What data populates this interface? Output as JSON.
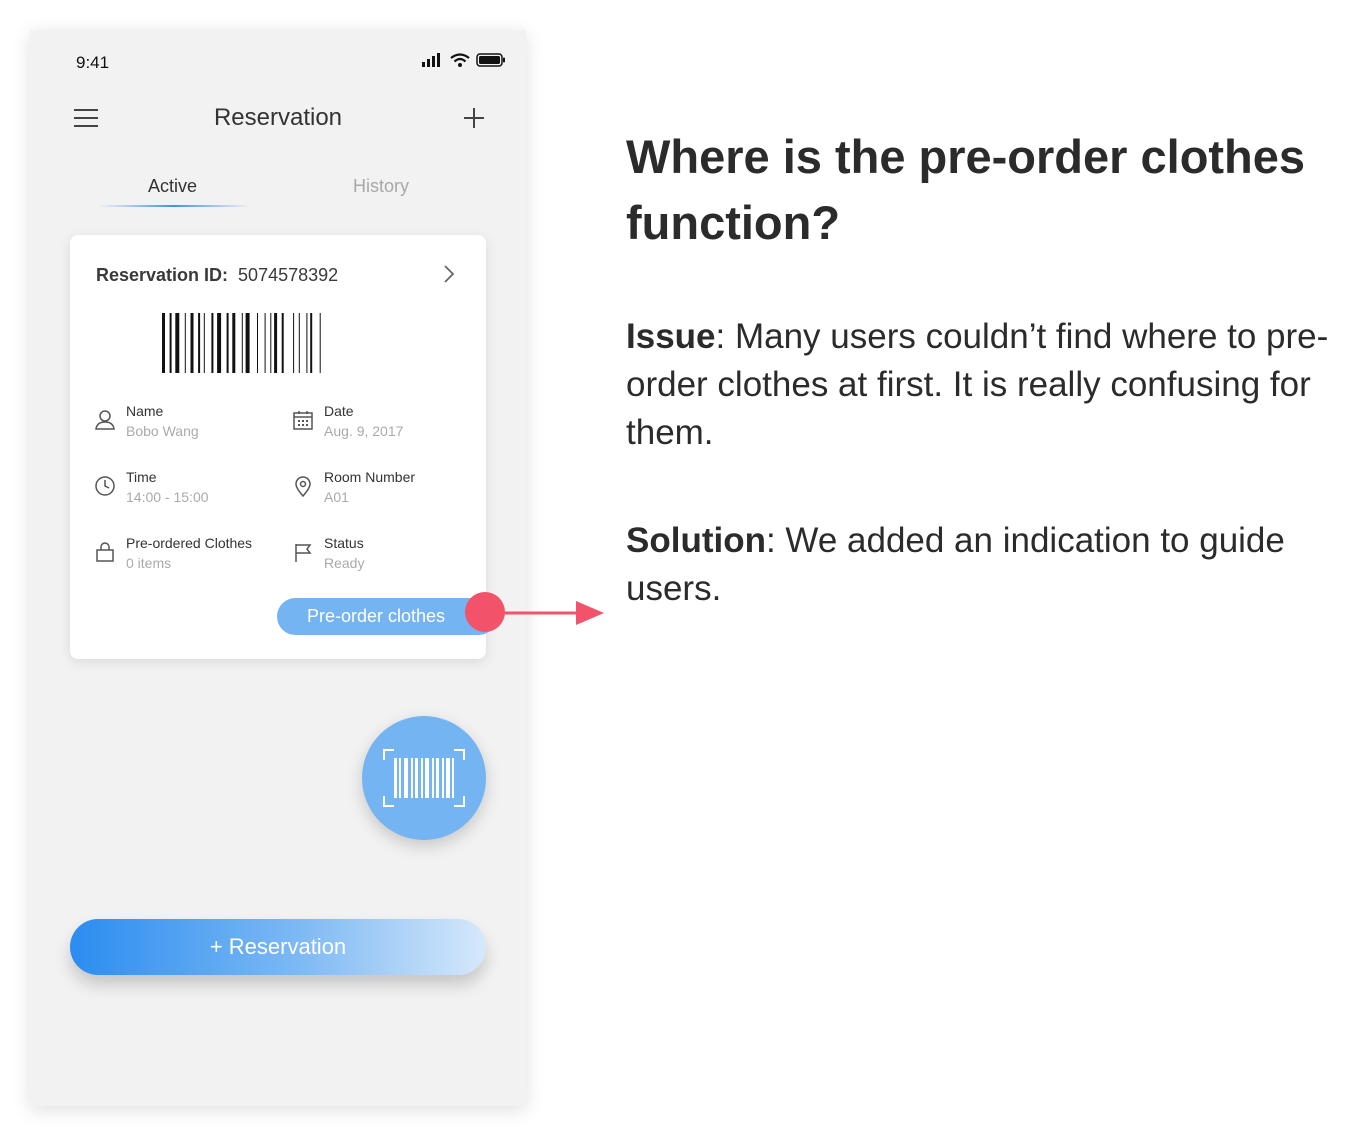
{
  "status_bar": {
    "time": "9:41"
  },
  "nav": {
    "title": "Reservation"
  },
  "tabs": [
    {
      "label": "Active"
    },
    {
      "label": "History"
    }
  ],
  "card": {
    "id_label": "Reservation ID:",
    "id_value": "5074578392",
    "fields": [
      {
        "label": "Name",
        "value": "Bobo Wang",
        "icon": "person-icon"
      },
      {
        "label": "Date",
        "value": "Aug. 9, 2017",
        "icon": "calendar-icon"
      },
      {
        "label": "Time",
        "value": "14:00 - 15:00",
        "icon": "clock-icon"
      },
      {
        "label": "Room Number",
        "value": "A01",
        "icon": "location-pin-icon"
      },
      {
        "label": "Pre-ordered Clothes",
        "value": "0 items",
        "icon": "shopping-bag-icon"
      },
      {
        "label": "Status",
        "value": "Ready",
        "icon": "flag-icon"
      }
    ],
    "preorder_button": "Pre-order clothes"
  },
  "add_reservation_button": "+ Reservation",
  "annotation": {
    "headline": "Where is the pre-order clothes function?",
    "issue_label": "Issue",
    "issue_text": ": Many users couldn’t find where to pre-order clothes at first. It is really confusing for them.",
    "solution_label": "Solution",
    "solution_text": ": We added an indication to guide users."
  },
  "colors": {
    "accent": "#74b4f2",
    "highlight": "#f2536a",
    "primary_gradient_start": "#2b8cf0"
  }
}
